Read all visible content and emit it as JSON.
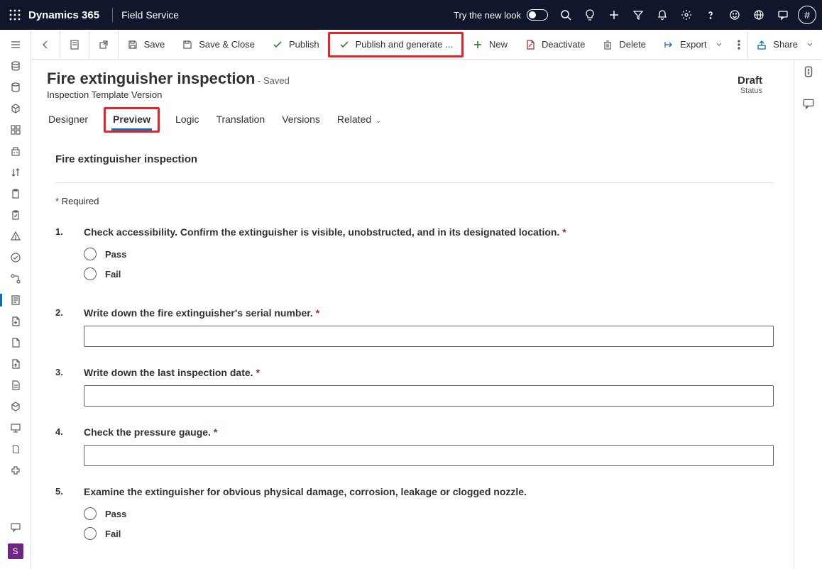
{
  "brand": "Dynamics 365",
  "app": "Field Service",
  "try_look": "Try the new look",
  "avatar": "#",
  "cmd": {
    "save": "Save",
    "saveclose": "Save & Close",
    "publish": "Publish",
    "publishgen": "Publish and generate ...",
    "new": "New",
    "deactivate": "Deactivate",
    "delete": "Delete",
    "export": "Export",
    "share": "Share"
  },
  "header": {
    "title": "Fire extinguisher inspection",
    "saved": "- Saved",
    "subtitle": "Inspection Template Version",
    "status_value": "Draft",
    "status_label": "Status"
  },
  "tabs": {
    "designer": "Designer",
    "preview": "Preview",
    "logic": "Logic",
    "translation": "Translation",
    "versions": "Versions",
    "related": "Related"
  },
  "form": {
    "title": "Fire extinguisher inspection",
    "required": "Required",
    "questions": [
      {
        "num": "1.",
        "text": "Check accessibility. Confirm the extinguisher is visible, unobstructed, and in its designated location.",
        "required": true,
        "type": "radio",
        "options": [
          "Pass",
          "Fail"
        ]
      },
      {
        "num": "2.",
        "text": "Write down the fire extinguisher's serial number.",
        "required": true,
        "type": "text"
      },
      {
        "num": "3.",
        "text": "Write down the last inspection date.",
        "required": true,
        "type": "text"
      },
      {
        "num": "4.",
        "text": "Check the pressure gauge.",
        "required": true,
        "type": "text"
      },
      {
        "num": "5.",
        "text": "Examine the extinguisher for obvious physical damage, corrosion, leakage or clogged nozzle.",
        "required": false,
        "type": "radio",
        "options": [
          "Pass",
          "Fail"
        ]
      }
    ]
  },
  "rail_app_letter": "S"
}
